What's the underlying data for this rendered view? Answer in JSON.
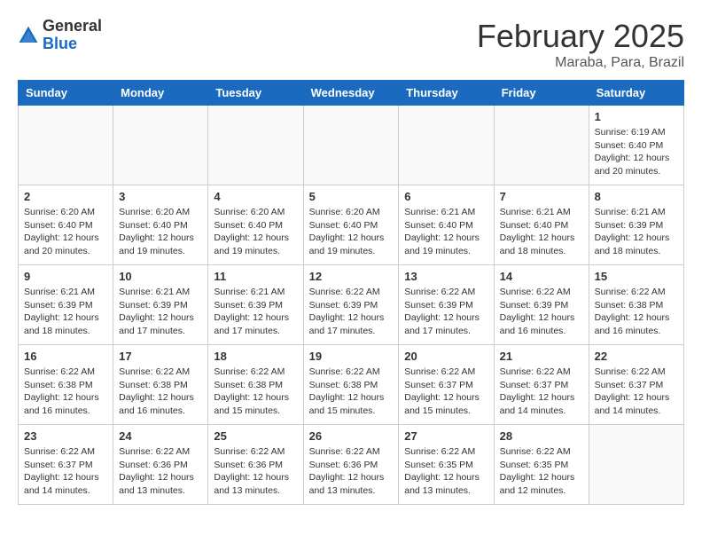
{
  "header": {
    "logo_general": "General",
    "logo_blue": "Blue",
    "title": "February 2025",
    "subtitle": "Maraba, Para, Brazil"
  },
  "weekdays": [
    "Sunday",
    "Monday",
    "Tuesday",
    "Wednesday",
    "Thursday",
    "Friday",
    "Saturday"
  ],
  "weeks": [
    [
      {
        "day": "",
        "info": ""
      },
      {
        "day": "",
        "info": ""
      },
      {
        "day": "",
        "info": ""
      },
      {
        "day": "",
        "info": ""
      },
      {
        "day": "",
        "info": ""
      },
      {
        "day": "",
        "info": ""
      },
      {
        "day": "1",
        "info": "Sunrise: 6:19 AM\nSunset: 6:40 PM\nDaylight: 12 hours\nand 20 minutes."
      }
    ],
    [
      {
        "day": "2",
        "info": "Sunrise: 6:20 AM\nSunset: 6:40 PM\nDaylight: 12 hours\nand 20 minutes."
      },
      {
        "day": "3",
        "info": "Sunrise: 6:20 AM\nSunset: 6:40 PM\nDaylight: 12 hours\nand 19 minutes."
      },
      {
        "day": "4",
        "info": "Sunrise: 6:20 AM\nSunset: 6:40 PM\nDaylight: 12 hours\nand 19 minutes."
      },
      {
        "day": "5",
        "info": "Sunrise: 6:20 AM\nSunset: 6:40 PM\nDaylight: 12 hours\nand 19 minutes."
      },
      {
        "day": "6",
        "info": "Sunrise: 6:21 AM\nSunset: 6:40 PM\nDaylight: 12 hours\nand 19 minutes."
      },
      {
        "day": "7",
        "info": "Sunrise: 6:21 AM\nSunset: 6:40 PM\nDaylight: 12 hours\nand 18 minutes."
      },
      {
        "day": "8",
        "info": "Sunrise: 6:21 AM\nSunset: 6:39 PM\nDaylight: 12 hours\nand 18 minutes."
      }
    ],
    [
      {
        "day": "9",
        "info": "Sunrise: 6:21 AM\nSunset: 6:39 PM\nDaylight: 12 hours\nand 18 minutes."
      },
      {
        "day": "10",
        "info": "Sunrise: 6:21 AM\nSunset: 6:39 PM\nDaylight: 12 hours\nand 17 minutes."
      },
      {
        "day": "11",
        "info": "Sunrise: 6:21 AM\nSunset: 6:39 PM\nDaylight: 12 hours\nand 17 minutes."
      },
      {
        "day": "12",
        "info": "Sunrise: 6:22 AM\nSunset: 6:39 PM\nDaylight: 12 hours\nand 17 minutes."
      },
      {
        "day": "13",
        "info": "Sunrise: 6:22 AM\nSunset: 6:39 PM\nDaylight: 12 hours\nand 17 minutes."
      },
      {
        "day": "14",
        "info": "Sunrise: 6:22 AM\nSunset: 6:39 PM\nDaylight: 12 hours\nand 16 minutes."
      },
      {
        "day": "15",
        "info": "Sunrise: 6:22 AM\nSunset: 6:38 PM\nDaylight: 12 hours\nand 16 minutes."
      }
    ],
    [
      {
        "day": "16",
        "info": "Sunrise: 6:22 AM\nSunset: 6:38 PM\nDaylight: 12 hours\nand 16 minutes."
      },
      {
        "day": "17",
        "info": "Sunrise: 6:22 AM\nSunset: 6:38 PM\nDaylight: 12 hours\nand 16 minutes."
      },
      {
        "day": "18",
        "info": "Sunrise: 6:22 AM\nSunset: 6:38 PM\nDaylight: 12 hours\nand 15 minutes."
      },
      {
        "day": "19",
        "info": "Sunrise: 6:22 AM\nSunset: 6:38 PM\nDaylight: 12 hours\nand 15 minutes."
      },
      {
        "day": "20",
        "info": "Sunrise: 6:22 AM\nSunset: 6:37 PM\nDaylight: 12 hours\nand 15 minutes."
      },
      {
        "day": "21",
        "info": "Sunrise: 6:22 AM\nSunset: 6:37 PM\nDaylight: 12 hours\nand 14 minutes."
      },
      {
        "day": "22",
        "info": "Sunrise: 6:22 AM\nSunset: 6:37 PM\nDaylight: 12 hours\nand 14 minutes."
      }
    ],
    [
      {
        "day": "23",
        "info": "Sunrise: 6:22 AM\nSunset: 6:37 PM\nDaylight: 12 hours\nand 14 minutes."
      },
      {
        "day": "24",
        "info": "Sunrise: 6:22 AM\nSunset: 6:36 PM\nDaylight: 12 hours\nand 13 minutes."
      },
      {
        "day": "25",
        "info": "Sunrise: 6:22 AM\nSunset: 6:36 PM\nDaylight: 12 hours\nand 13 minutes."
      },
      {
        "day": "26",
        "info": "Sunrise: 6:22 AM\nSunset: 6:36 PM\nDaylight: 12 hours\nand 13 minutes."
      },
      {
        "day": "27",
        "info": "Sunrise: 6:22 AM\nSunset: 6:35 PM\nDaylight: 12 hours\nand 13 minutes."
      },
      {
        "day": "28",
        "info": "Sunrise: 6:22 AM\nSunset: 6:35 PM\nDaylight: 12 hours\nand 12 minutes."
      },
      {
        "day": "",
        "info": ""
      }
    ]
  ]
}
